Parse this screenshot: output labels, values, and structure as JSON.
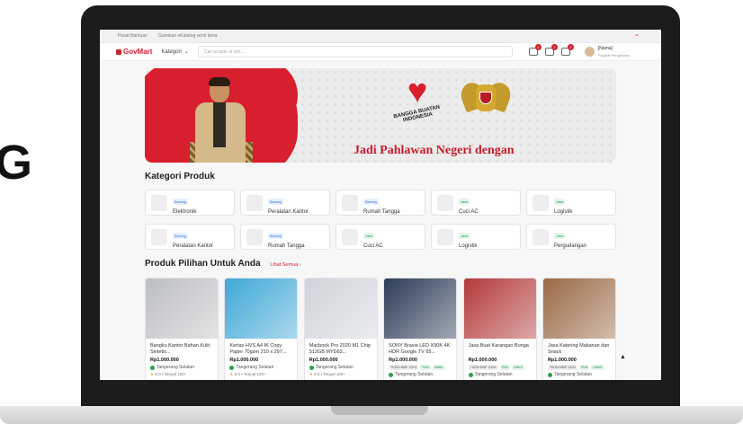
{
  "left_letter": "G",
  "topbar": {
    "links": [
      "Pusat Bantuan",
      "Gunakan eKatalog versi lama"
    ]
  },
  "nav": {
    "logo": "GovMart",
    "kategori": "Kategori",
    "search_placeholder": "Cari produk di sini...",
    "badges": [
      "2",
      "2",
      "2"
    ],
    "user_name": "[Nama]",
    "user_role": "Pejabat Pengadaan"
  },
  "banner": {
    "bangga_text": "BANGGA BUATAN INDONESIA",
    "tagline": "Jadi Pahlawan Negeri dengan"
  },
  "categories": {
    "title": "Kategori Produk",
    "items": [
      {
        "tag": "Barang",
        "name": "Elektronik"
      },
      {
        "tag": "Barang",
        "name": "Peralatan Kantor"
      },
      {
        "tag": "Barang",
        "name": "Rumah Tangga"
      },
      {
        "tag": "Jasa",
        "name": "Cuci AC"
      },
      {
        "tag": "Jasa",
        "name": "Logistik"
      },
      {
        "tag": "Barang",
        "name": "Peralatan Kantor"
      },
      {
        "tag": "Barang",
        "name": "Rumah Tangga"
      },
      {
        "tag": "Jasa",
        "name": "Cuci AC"
      },
      {
        "tag": "Jasa",
        "name": "Logistik"
      },
      {
        "tag": "Jasa",
        "name": "Pergudangan"
      }
    ]
  },
  "products": {
    "title": "Produk Pilihan Untuk Anda",
    "see_all": "Lihat Semua",
    "items": [
      {
        "name": "Bangku Kantor Bahan Kulit Sintetis...",
        "price": "Rp1.000.000",
        "location": "Tangerang Selatan",
        "rating": "5.0 • Terjual 100+",
        "chips": [],
        "thumb": "#bcbfc3"
      },
      {
        "name": "Kertas HVS A4 IK Copy Paper 70gsm 210 x 297...",
        "price": "Rp1.000.000",
        "location": "Tangerang Selatan",
        "rating": "5.0 • Terjual 100+",
        "chips": [],
        "thumb": "#3fa8d6"
      },
      {
        "name": "Macbook Pro 2020 M1 Chip 512GB MYD82...",
        "price": "Rp1.000.000",
        "location": "Tangerang Selatan",
        "rating": "5.0 • Terjual 100+",
        "chips": [],
        "thumb": "#cfd4da"
      },
      {
        "name": "SONY Bravia LED X90K 4K HDR Google TV 65...",
        "price": "Rp1.000.000",
        "location": "Tangerang Selatan",
        "rating": "",
        "chips": [
          "TKDN+BMP 100%",
          "PDN",
          "UMKK"
        ],
        "thumb": "#2c3d57"
      },
      {
        "name": "Jasa Buat Karangan Bunga",
        "price": "Rp1.000.000",
        "location": "Tangerang Selatan",
        "rating": "",
        "chips": [
          "TKDN+BMP 100%",
          "PDN",
          "UMKK"
        ],
        "thumb": "#b33a3a"
      },
      {
        "name": "Jasa Katering Makanan dan Snack",
        "price": "Rp1.000.000",
        "location": "Tangerang Selatan",
        "rating": "",
        "chips": [
          "TKDN+BMP 100%",
          "PDN",
          "UMKK"
        ],
        "thumb": "#9a6a45"
      }
    ]
  },
  "colors": {
    "brand": "#d01f2d",
    "banner_red": "#d81f2e"
  }
}
